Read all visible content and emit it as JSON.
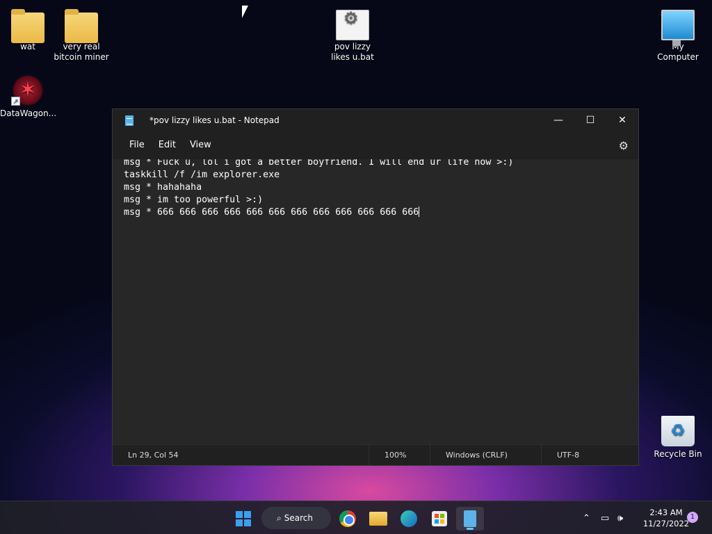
{
  "desktop": {
    "icons": [
      {
        "label": "wat"
      },
      {
        "label": "very real bitcoin miner"
      },
      {
        "label": "pov lizzy likes u.bat"
      },
      {
        "label": "My Computer"
      },
      {
        "label": "DataWagon..."
      },
      {
        "label": "Recycle Bin"
      }
    ]
  },
  "notepad": {
    "title": "*pov lizzy likes u.bat - Notepad",
    "menu": [
      "File",
      "Edit",
      "View"
    ],
    "content": "msg * Fuck u, lol i got a better boyfriend. I will end ur life now >:)\ntaskkill /f /im explorer.exe\nmsg * hahahaha\nmsg * im too powerful >:)\nmsg * 666 666 666 666 666 666 666 666 666 666 666 666",
    "status": {
      "position": "Ln 29, Col 54",
      "zoom": "100%",
      "line_ending": "Windows (CRLF)",
      "encoding": "UTF-8"
    }
  },
  "taskbar": {
    "search_label": "Search",
    "time": "2:43 AM",
    "date": "11/27/2022",
    "notification_count": "1"
  }
}
